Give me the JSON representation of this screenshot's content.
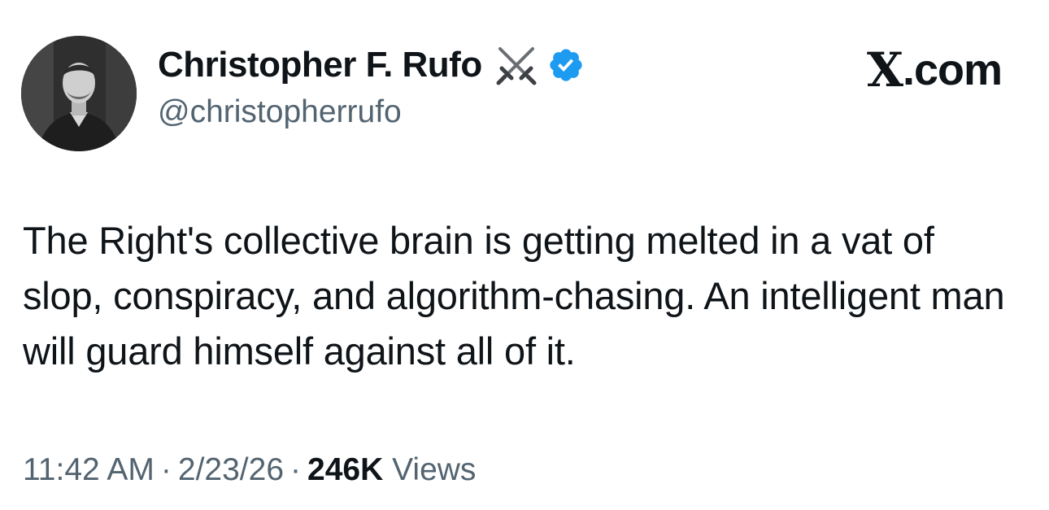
{
  "author": {
    "display_name": "Christopher F. Rufo",
    "handle": "@christopherrufo",
    "name_emoji": "crossed-swords-icon",
    "verified": true,
    "verified_color": "#1d9bf0"
  },
  "brand": {
    "label": ".com",
    "logo": "X"
  },
  "tweet": {
    "text": "The Right's collective brain is getting melted in a vat of slop, conspiracy, and algorithm-chasing. An intelligent man will guard himself against all of it."
  },
  "meta": {
    "time": "11:42 AM",
    "date": "2/23/26",
    "separator": "·",
    "views_count": "246K",
    "views_label": "Views"
  },
  "colors": {
    "text_primary": "#0f1419",
    "text_secondary": "#536471"
  }
}
